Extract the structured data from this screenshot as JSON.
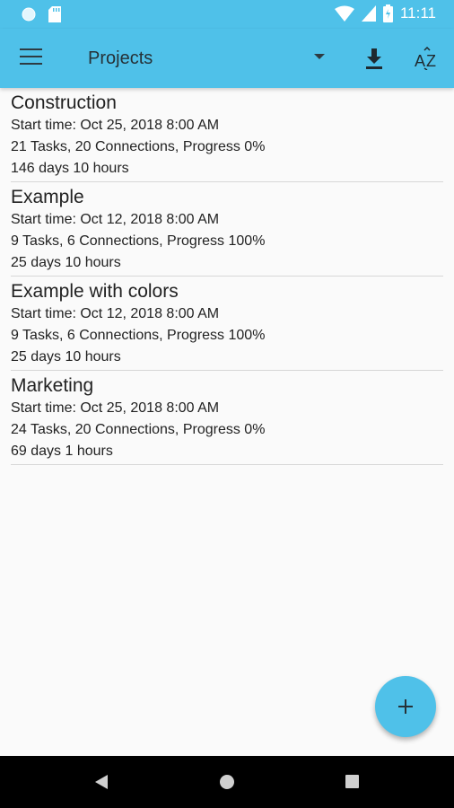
{
  "status_bar": {
    "time": "11:11"
  },
  "app_bar": {
    "title": "Projects"
  },
  "projects": [
    {
      "name": "Construction",
      "start": "Start time: Oct 25, 2018 8:00 AM",
      "summary": "21 Tasks, 20 Connections, Progress 0%",
      "duration": "146 days 10 hours"
    },
    {
      "name": "Example",
      "start": "Start time: Oct 12, 2018 8:00 AM",
      "summary": "9 Tasks, 6 Connections, Progress 100%",
      "duration": "25 days 10 hours"
    },
    {
      "name": "Example with colors",
      "start": "Start time: Oct 12, 2018 8:00 AM",
      "summary": "9 Tasks, 6 Connections, Progress 100%",
      "duration": "25 days 10 hours"
    },
    {
      "name": "Marketing",
      "start": "Start time: Oct 25, 2018 8:00 AM",
      "summary": "24 Tasks, 20 Connections, Progress 0%",
      "duration": "69 days 1 hours"
    }
  ],
  "colors": {
    "accent": "#4fc1e9",
    "text": "#222222",
    "divider": "#d7d7d7"
  },
  "icons": {
    "menu": "hamburger-menu-icon",
    "dropdown": "dropdown-arrow-icon",
    "download": "download-icon",
    "sort": "sort-az-icon",
    "fab": "plus-icon"
  }
}
